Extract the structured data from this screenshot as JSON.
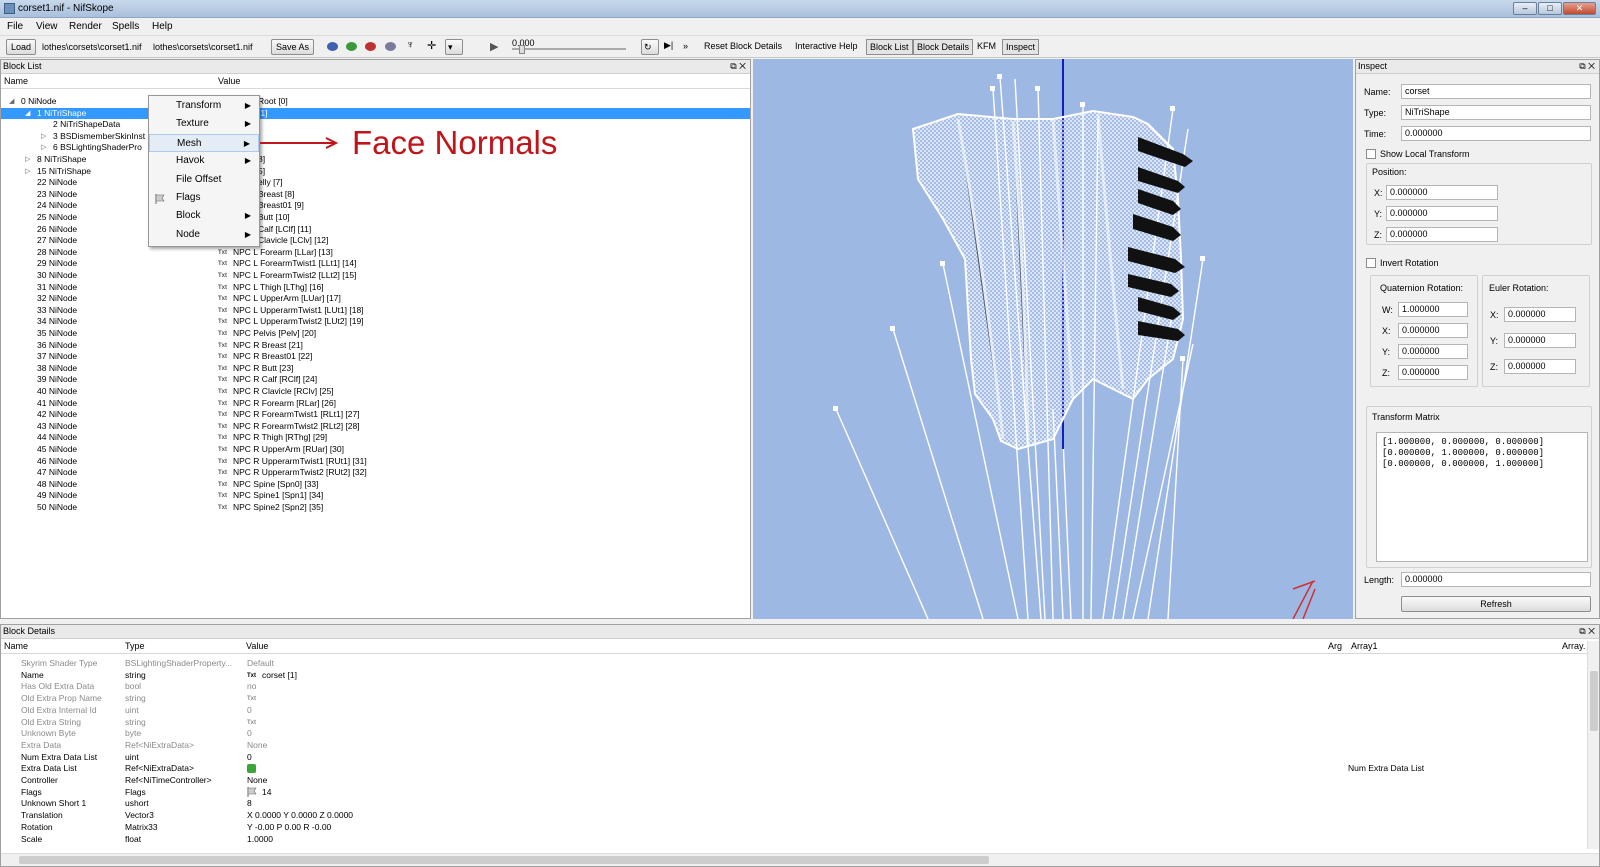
{
  "window": {
    "title": "corset1.nif - NifSkope"
  },
  "menu": [
    "File",
    "View",
    "Render",
    "Spells",
    "Help"
  ],
  "toolbar": {
    "load": "Load",
    "load_path": "lothes\\corsets\\corset1.nif",
    "save_path": "lothes\\corsets\\corset1.nif",
    "save_as": "Save As",
    "time_value": "0.000",
    "more": "»",
    "reset_block_details": "Reset Block Details",
    "interactive_help": "Interactive Help",
    "block_list": "Block List",
    "block_details": "Block Details",
    "kfm": "KFM",
    "inspect": "Inspect"
  },
  "block_list": {
    "header": "Block List",
    "col_name": "Name",
    "col_value": "Value",
    "rows": [
      {
        "name": "0 NiNode",
        "value": "Root [0]",
        "indent": 0,
        "arrow": "◢",
        "txt": false
      },
      {
        "name": "1 NiTriShape",
        "value": "[1]",
        "indent": 1,
        "arrow": "◢",
        "txt": false,
        "selected": true
      },
      {
        "name": "2 NiTriShapeData",
        "value": "",
        "indent": 2,
        "arrow": "",
        "txt": false
      },
      {
        "name": "3 BSDismemberSkinInst",
        "value": "",
        "indent": 2,
        "arrow": "▷",
        "txt": false
      },
      {
        "name": "6 BSLightingShaderPro",
        "value": "",
        "indent": 2,
        "arrow": "▷",
        "txt": false
      },
      {
        "name": "8 NiTriShape",
        "value": "8]",
        "indent": 1,
        "arrow": "▷",
        "txt": false
      },
      {
        "name": "15 NiTriShape",
        "value": "5]",
        "indent": 1,
        "arrow": "▷",
        "txt": false
      },
      {
        "name": "22 NiNode",
        "value": "elly [7]",
        "indent": 1,
        "arrow": "",
        "txt": false
      },
      {
        "name": "23 NiNode",
        "value": "Breast [8]",
        "indent": 1,
        "arrow": "",
        "txt": false
      },
      {
        "name": "24 NiNode",
        "value": "Breast01 [9]",
        "indent": 1,
        "arrow": "",
        "txt": false
      },
      {
        "name": "25 NiNode",
        "value": "Butt [10]",
        "indent": 1,
        "arrow": "",
        "txt": false
      },
      {
        "name": "26 NiNode",
        "value": "Calf [LClf] [11]",
        "indent": 1,
        "arrow": "",
        "txt": false
      },
      {
        "name": "27 NiNode",
        "value": "Clavicle [LClv] [12]",
        "indent": 1,
        "arrow": "",
        "txt": false
      },
      {
        "name": "28 NiNode",
        "value": "NPC L Forearm [LLar] [13]",
        "indent": 1,
        "arrow": "",
        "txt": true
      },
      {
        "name": "29 NiNode",
        "value": "NPC L ForearmTwist1 [LLt1] [14]",
        "indent": 1,
        "arrow": "",
        "txt": true
      },
      {
        "name": "30 NiNode",
        "value": "NPC L ForearmTwist2 [LLt2] [15]",
        "indent": 1,
        "arrow": "",
        "txt": true
      },
      {
        "name": "31 NiNode",
        "value": "NPC L Thigh [LThg] [16]",
        "indent": 1,
        "arrow": "",
        "txt": true
      },
      {
        "name": "32 NiNode",
        "value": "NPC L UpperArm [LUar] [17]",
        "indent": 1,
        "arrow": "",
        "txt": true
      },
      {
        "name": "33 NiNode",
        "value": "NPC L UpperarmTwist1 [LUt1] [18]",
        "indent": 1,
        "arrow": "",
        "txt": true
      },
      {
        "name": "34 NiNode",
        "value": "NPC L UpperarmTwist2 [LUt2] [19]",
        "indent": 1,
        "arrow": "",
        "txt": true
      },
      {
        "name": "35 NiNode",
        "value": "NPC Pelvis [Pelv] [20]",
        "indent": 1,
        "arrow": "",
        "txt": true
      },
      {
        "name": "36 NiNode",
        "value": "NPC R Breast [21]",
        "indent": 1,
        "arrow": "",
        "txt": true
      },
      {
        "name": "37 NiNode",
        "value": "NPC R Breast01 [22]",
        "indent": 1,
        "arrow": "",
        "txt": true
      },
      {
        "name": "38 NiNode",
        "value": "NPC R Butt [23]",
        "indent": 1,
        "arrow": "",
        "txt": true
      },
      {
        "name": "39 NiNode",
        "value": "NPC R Calf [RClf] [24]",
        "indent": 1,
        "arrow": "",
        "txt": true
      },
      {
        "name": "40 NiNode",
        "value": "NPC R Clavicle [RClv] [25]",
        "indent": 1,
        "arrow": "",
        "txt": true
      },
      {
        "name": "41 NiNode",
        "value": "NPC R Forearm [RLar] [26]",
        "indent": 1,
        "arrow": "",
        "txt": true
      },
      {
        "name": "42 NiNode",
        "value": "NPC R ForearmTwist1 [RLt1] [27]",
        "indent": 1,
        "arrow": "",
        "txt": true
      },
      {
        "name": "43 NiNode",
        "value": "NPC R ForearmTwist2 [RLt2] [28]",
        "indent": 1,
        "arrow": "",
        "txt": true
      },
      {
        "name": "44 NiNode",
        "value": "NPC R Thigh [RThg] [29]",
        "indent": 1,
        "arrow": "",
        "txt": true
      },
      {
        "name": "45 NiNode",
        "value": "NPC R UpperArm [RUar] [30]",
        "indent": 1,
        "arrow": "",
        "txt": true
      },
      {
        "name": "46 NiNode",
        "value": "NPC R UpperarmTwist1 [RUt1] [31]",
        "indent": 1,
        "arrow": "",
        "txt": true
      },
      {
        "name": "47 NiNode",
        "value": "NPC R UpperarmTwist2 [RUt2] [32]",
        "indent": 1,
        "arrow": "",
        "txt": true
      },
      {
        "name": "48 NiNode",
        "value": "NPC Spine [Spn0] [33]",
        "indent": 1,
        "arrow": "",
        "txt": true
      },
      {
        "name": "49 NiNode",
        "value": "NPC Spine1 [Spn1] [34]",
        "indent": 1,
        "arrow": "",
        "txt": true
      },
      {
        "name": "50 NiNode",
        "value": "NPC Spine2 [Spn2] [35]",
        "indent": 1,
        "arrow": "",
        "txt": true
      }
    ]
  },
  "context_menu": {
    "items": [
      {
        "label": "Transform",
        "submenu": true
      },
      {
        "label": "Texture",
        "submenu": true
      },
      {
        "label": "Mesh",
        "submenu": true,
        "highlighted": true
      },
      {
        "label": "Havok",
        "submenu": true
      },
      {
        "label": "File Offset",
        "submenu": false
      },
      {
        "label": "Flags",
        "submenu": false,
        "icon": "flag-icon"
      },
      {
        "label": "Block",
        "submenu": true
      },
      {
        "label": "Node",
        "submenu": true
      }
    ]
  },
  "annotation": {
    "text": "Face Normals",
    "color": "#c0161b"
  },
  "inspect": {
    "header": "Inspect",
    "name_label": "Name:",
    "name_value": "corset",
    "type_label": "Type:",
    "type_value": "NiTriShape",
    "time_label": "Time:",
    "time_value": "0.000000",
    "show_local_transform": "Show Local Transform",
    "position_label": "Position:",
    "pos_x_label": "X:",
    "pos_x": "0.000000",
    "pos_y_label": "Y:",
    "pos_y": "0.000000",
    "pos_z_label": "Z:",
    "pos_z": "0.000000",
    "invert_rotation": "Invert Rotation",
    "quat_label": "Quaternion Rotation:",
    "euler_label": "Euler Rotation:",
    "q_w_label": "W:",
    "q_w": "1.000000",
    "q_x_label": "X:",
    "q_x": "0.000000",
    "q_y_label": "Y:",
    "q_y": "0.000000",
    "q_z_label": "Z:",
    "q_z": "0.000000",
    "e_x_label": "X:",
    "e_x": "0.000000",
    "e_y_label": "Y:",
    "e_y": "0.000000",
    "e_z_label": "Z:",
    "e_z": "0.000000",
    "matrix_label": "Transform Matrix",
    "matrix_rows": [
      "[1.000000, 0.000000, 0.000000]",
      "[0.000000, 1.000000, 0.000000]",
      "[0.000000, 0.000000, 1.000000]"
    ],
    "length_label": "Length:",
    "length_value": "0.000000",
    "refresh": "Refresh"
  },
  "block_details": {
    "header": "Block Details",
    "col_name": "Name",
    "col_type": "Type",
    "col_value": "Value",
    "col_arg": "Arg",
    "col_array1": "Array1",
    "col_array2": "Array.",
    "rows": [
      {
        "name": "Skyrim Shader Type",
        "type": "BSLightingShaderProperty...",
        "value": "Default",
        "gray": true,
        "txt": false,
        "extra": ""
      },
      {
        "name": "Name",
        "type": "string",
        "value": "corset [1]",
        "gray": false,
        "txt": true,
        "extra": ""
      },
      {
        "name": "Has Old Extra Data",
        "type": "bool",
        "value": "no",
        "gray": true,
        "txt": false,
        "extra": ""
      },
      {
        "name": "Old Extra Prop Name",
        "type": "string",
        "value": "",
        "gray": true,
        "txt": true,
        "extra": ""
      },
      {
        "name": "Old Extra Internal Id",
        "type": "uint",
        "value": "0",
        "gray": true,
        "txt": false,
        "extra": ""
      },
      {
        "name": "Old Extra String",
        "type": "string",
        "value": "",
        "gray": true,
        "txt": true,
        "extra": ""
      },
      {
        "name": "Unknown Byte",
        "type": "byte",
        "value": "0",
        "gray": true,
        "txt": false,
        "extra": ""
      },
      {
        "name": "Extra Data",
        "type": "Ref<NiExtraData>",
        "value": "None",
        "gray": true,
        "txt": false,
        "extra": ""
      },
      {
        "name": "Num Extra Data List",
        "type": "uint",
        "value": "0",
        "gray": false,
        "txt": false,
        "extra": ""
      },
      {
        "name": "Extra Data List",
        "type": "Ref<NiExtraData>",
        "value": "",
        "gray": false,
        "txt": false,
        "extra": "Num Extra Data List",
        "icon": "green-icon"
      },
      {
        "name": "Controller",
        "type": "Ref<NiTimeController>",
        "value": "None",
        "gray": false,
        "txt": false,
        "extra": ""
      },
      {
        "name": "Flags",
        "type": "Flags",
        "value": "14",
        "gray": false,
        "txt": false,
        "extra": "",
        "icon": "flag-icon"
      },
      {
        "name": "Unknown Short 1",
        "type": "ushort",
        "value": "8",
        "gray": false,
        "txt": false,
        "extra": ""
      },
      {
        "name": "Translation",
        "type": "Vector3",
        "value": "X 0.0000 Y 0.0000 Z 0.0000",
        "gray": false,
        "txt": false,
        "extra": ""
      },
      {
        "name": "Rotation",
        "type": "Matrix33",
        "value": "Y -0.00 P 0.00 R -0.00",
        "gray": false,
        "txt": false,
        "extra": ""
      },
      {
        "name": "Scale",
        "type": "float",
        "value": "1.0000",
        "gray": false,
        "txt": false,
        "extra": ""
      }
    ]
  },
  "colors": {
    "viewport_bg": "#9eb8e4",
    "selection": "#3399ff",
    "annotation": "#c0161b"
  }
}
